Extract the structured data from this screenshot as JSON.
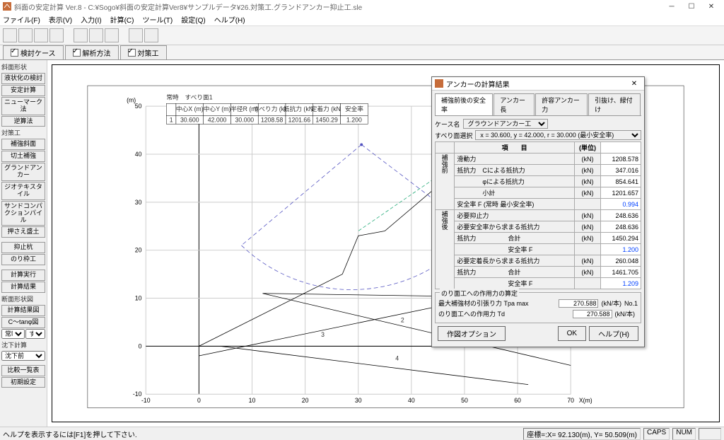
{
  "title": "斜面の安定計算 Ver.8 - C:¥Sogo¥斜面の安定計算Ver8¥サンプルデータ¥26.対策工.グランドアンカー抑止工.sle",
  "menu": [
    "ファイル(F)",
    "表示(V)",
    "入力(I)",
    "計算(C)",
    "ツール(T)",
    "設定(Q)",
    "ヘルプ(H)"
  ],
  "tabs": [
    {
      "label": "検討ケース",
      "checked": true
    },
    {
      "label": "解析方法",
      "checked": true
    },
    {
      "label": "対策工",
      "checked": true
    }
  ],
  "sidebar_section1_header": "斜面形状",
  "sidebar_section1": [
    "液状化の検討",
    "安定計算",
    "ニューマーク法",
    "逆算法"
  ],
  "sidebar_section2_header": "対策工",
  "sidebar_section2": [
    "補強斜面",
    "切土補強",
    "グランドアンカー",
    "ジオテキスタイル",
    "サンドコンパクションパイル",
    "押さえ盛土"
  ],
  "sidebar_section3": [
    "抑止杭",
    "のり枠工"
  ],
  "sidebar_section4": [
    "計算実行",
    "計算結果"
  ],
  "sidebar_section5_header": "断面形状図",
  "sidebar_section5": [
    "計算結果図"
  ],
  "sidebar_tanphi": "C～tanφ図",
  "sidebar_sel1": "常時",
  "sidebar_sel1b": "すべ",
  "sidebar_under_header": "沈下計算",
  "sidebar_sel2": "沈下前",
  "sidebar_bottom": [
    "比較一覧表",
    "初期設定"
  ],
  "chart_header": "常時　すべり面1",
  "chart_units": "(m)",
  "chart_xunits": "X(m)",
  "chart_data": {
    "type": "engineering-section",
    "x_ticks": [
      -10,
      0,
      10,
      20,
      30,
      40,
      50,
      60,
      70
    ],
    "y_ticks": [
      -10,
      0,
      10,
      20,
      30,
      40,
      50
    ],
    "table": {
      "headers": [
        "",
        "中心X (m)",
        "中心Y (m)",
        "半径R (m)",
        "すべり力 (kN)",
        "抵抗力 (kN)",
        "定着力 (kN)",
        "安全率"
      ],
      "row": [
        "1",
        "30.600",
        "42.000",
        "30.000",
        "1208.58",
        "1201.66",
        "1450.29",
        "1.200"
      ]
    },
    "layers": [
      {
        "kind": "ground_surface",
        "points": [
          [
            0,
            0
          ],
          [
            27,
            15
          ],
          [
            30,
            23
          ],
          [
            35,
            24
          ],
          [
            52,
            40
          ],
          [
            58,
            40
          ],
          [
            70,
            45
          ]
        ]
      },
      {
        "kind": "line",
        "points": [
          [
            0,
            0
          ],
          [
            70,
            0
          ]
        ]
      },
      {
        "kind": "line",
        "points": [
          [
            0,
            -2
          ],
          [
            70,
            14
          ]
        ]
      },
      {
        "kind": "line",
        "points": [
          [
            4,
            0
          ],
          [
            62,
            -8
          ]
        ]
      },
      {
        "kind": "layer_boundary",
        "points": [
          [
            12,
            11
          ],
          [
            70,
            -4
          ]
        ]
      },
      {
        "kind": "layer_boundary",
        "points": [
          [
            12,
            11
          ],
          [
            70,
            10
          ]
        ]
      },
      {
        "kind": "slip_circle",
        "cx": 30.6,
        "cy": 42.0,
        "r": 30.0,
        "arc_from": [
          8,
          21
        ],
        "arc_to": [
          52,
          24
        ],
        "dashed": true
      },
      {
        "kind": "anchor",
        "from": [
          52,
          40
        ],
        "to": [
          52,
          8
        ],
        "dashed": true,
        "color": "green"
      },
      {
        "kind": "anchor",
        "from": [
          51,
          40
        ],
        "to": [
          30,
          24
        ],
        "dashed": true,
        "color": "green"
      }
    ],
    "region_labels": [
      {
        "text": "2",
        "x": 38,
        "y": 5
      },
      {
        "text": "3",
        "x": 23,
        "y": 2
      },
      {
        "text": "4",
        "x": 37,
        "y": -3
      }
    ]
  },
  "dialog": {
    "title": "アンカーの計算結果",
    "tabs": [
      "補強前後の安全率",
      "アンカー長",
      "許容アンカー力",
      "引抜け、緑付け"
    ],
    "active_tab": 0,
    "case_label": "ケース名",
    "case_value": "グラウンドアンカー工",
    "slip_label": "すべり面選択",
    "slip_value": "x = 30.600, y = 42.000, r = 30.000 (最小安全率)",
    "group_before": "補強前",
    "group_after": "補強後",
    "cols": {
      "item": "項　　目",
      "unit": "(単位)"
    },
    "rows": [
      {
        "item": "滑動力",
        "unit": "(kN)",
        "val": "1208.578",
        "blue": false
      },
      {
        "item": "抵抗力　Cによる抵抗力",
        "unit": "(kN)",
        "val": "347.016",
        "blue": false
      },
      {
        "item": "　　　　φによる抵抗力",
        "unit": "(kN)",
        "val": "854.641",
        "blue": false
      },
      {
        "item": "　　　　小計",
        "unit": "(kN)",
        "val": "1201.657",
        "blue": false
      },
      {
        "item": "安全率 F (常時 最小安全率)",
        "unit": "",
        "val": "0.994",
        "blue": true
      },
      {
        "item": "必要抑止力",
        "unit": "(kN)",
        "val": "248.636",
        "blue": false
      },
      {
        "item": "必要安全率から求まる抵抗力",
        "unit": "(kN)",
        "val": "248.636",
        "blue": false
      },
      {
        "item": "抵抗力　　　　　合計",
        "unit": "(kN)",
        "val": "1450.294",
        "blue": false
      },
      {
        "item": "　　　　　　　　安全率 F",
        "unit": "",
        "val": "1.200",
        "blue": true
      },
      {
        "item": "必要定着長から求まる抵抗力",
        "unit": "(kN)",
        "val": "260.048",
        "blue": false
      },
      {
        "item": "抵抗力　　　　　合計",
        "unit": "(kN)",
        "val": "1461.705",
        "blue": false
      },
      {
        "item": "　　　　　　　　安全率 F",
        "unit": "",
        "val": "1.209",
        "blue": true
      }
    ],
    "force_group": "のり面工への作用力の算定",
    "force_rows": [
      {
        "label": "最大補強材の引張り力 Tpa max",
        "val": "270.588",
        "unit": "(kN/本)",
        "note": "No.1"
      },
      {
        "label": "のり面工への作用力 Td",
        "val": "270.588",
        "unit": "(kN/本)",
        "note": ""
      }
    ],
    "option_btn": "作図オプション",
    "ok": "OK",
    "help": "ヘルプ(H)"
  },
  "status": {
    "left": "ヘルプを表示するには[F1]を押して下さい.",
    "coord": "座標=:X= 92.130(m), Y= 50.509(m)",
    "caps": "CAPS",
    "num": "NUM"
  }
}
